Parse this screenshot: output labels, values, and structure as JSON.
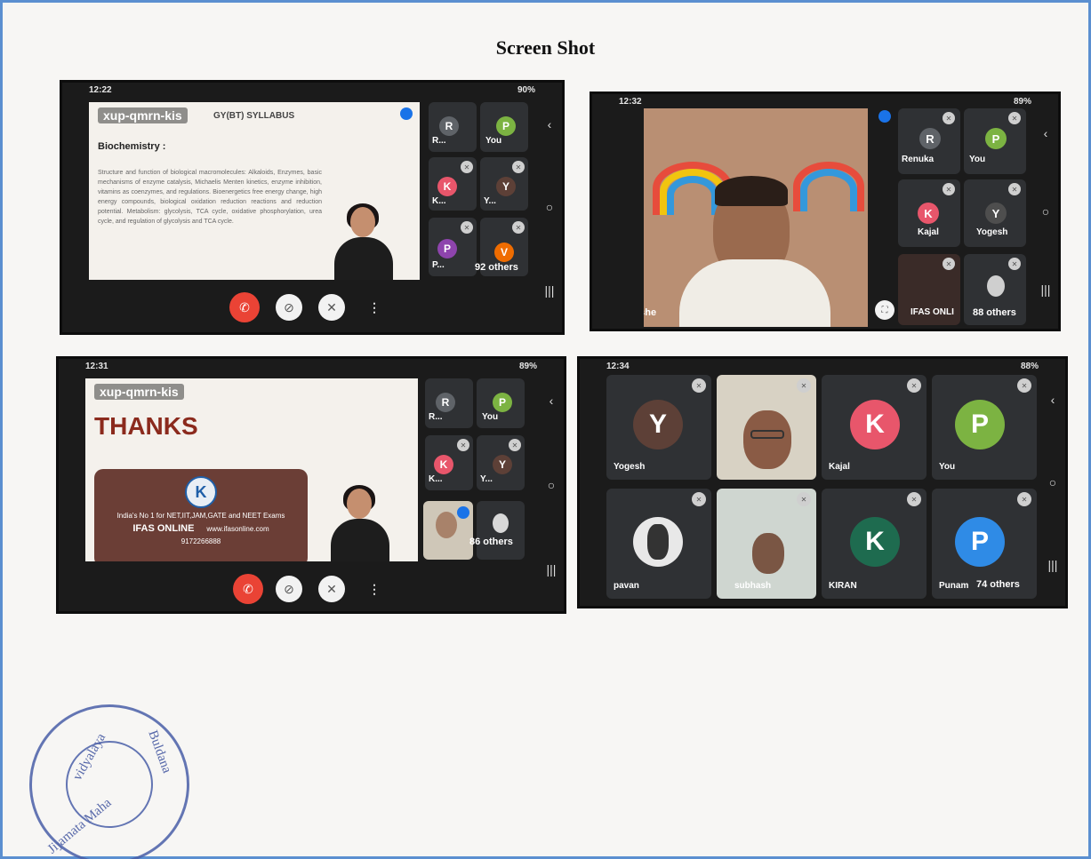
{
  "page": {
    "title": "Screen Shot"
  },
  "screenshots": [
    {
      "status_time": "12:22",
      "status_right": "90%",
      "slide": {
        "meeting_code": "xup-qmrn-kis",
        "header_fragment": "GY(BT) SYLLABUS",
        "heading": "Biochemistry :",
        "body": "Structure and function of biological macromolecules: Alkaloids, Enzymes, basic mechanisms of enzyme catalysis, Michaelis Menten kinetics, enzyme inhibition, vitamins as coenzymes, and regulations. Bioenergetics free energy change, high energy compounds, biological oxidation reduction reactions and reduction potential. Metabolism: glycolysis, TCA cycle, oxidative phosphorylation, urea cycle, and regulation of glycolysis and TCA cycle."
      },
      "tiles": [
        {
          "initial": "R",
          "label": "R...",
          "color": "#5f6368"
        },
        {
          "initial": "P",
          "label": "You",
          "color": "#7cb342"
        },
        {
          "initial": "K",
          "label": "K...",
          "color": "#e8566b"
        },
        {
          "initial": "Y",
          "label": "Y...",
          "color": "#5d4037"
        },
        {
          "initial": "P",
          "label": "P...",
          "color": "#8e44ad"
        },
        {
          "initial": "V",
          "label": "92 others",
          "color": "#ef6c00"
        }
      ]
    },
    {
      "status_time": "12:32",
      "status_right": "89%",
      "main_label": "prashe",
      "tiles": [
        {
          "initial": "R",
          "label": "Renuka",
          "color": "#5f6368"
        },
        {
          "initial": "P",
          "label": "You",
          "color": "#7cb342"
        },
        {
          "initial": "K",
          "label": "Kajal",
          "color": "#e8566b"
        },
        {
          "initial": "Y",
          "label": "Yogesh",
          "color": "#4e4e4e"
        },
        {
          "initial": "",
          "label": "IFAS ONLI",
          "color": "#3a2b28"
        },
        {
          "initial": "",
          "label": "88 others",
          "color": "#2f3134"
        }
      ]
    },
    {
      "status_time": "12:31",
      "status_right": "89%",
      "slide": {
        "meeting_code": "xup-qmrn-kis",
        "thanks": "THANKS",
        "tagline": "India's No 1 for NET,IIT,JAM,GATE and NEET Exams",
        "brand": "IFAS ONLINE",
        "url": "www.ifasonline.com",
        "phone": "9172266888"
      },
      "tiles": [
        {
          "initial": "R",
          "label": "R...",
          "color": "#5f6368"
        },
        {
          "initial": "P",
          "label": "You",
          "color": "#7cb342"
        },
        {
          "initial": "K",
          "label": "K...",
          "color": "#e8566b"
        },
        {
          "initial": "Y",
          "label": "Y...",
          "color": "#5d4037"
        },
        {
          "initial": "",
          "label": "",
          "color": "#cfc7b8"
        },
        {
          "initial": "",
          "label": "86 others",
          "color": "#2f3134"
        }
      ]
    },
    {
      "status_time": "12:34",
      "status_right": "88%",
      "tiles": [
        {
          "initial": "Y",
          "label": "Yogesh",
          "color": "#5d4037"
        },
        {
          "initial": "",
          "label": "",
          "color": "#d8d2c4"
        },
        {
          "initial": "K",
          "label": "Kajal",
          "color": "#e8566b"
        },
        {
          "initial": "P",
          "label": "You",
          "color": "#7cb342"
        },
        {
          "initial": "",
          "label": "pavan",
          "color": "#3a3a3a"
        },
        {
          "initial": "",
          "label": "subhash",
          "color": "#cfd6d0"
        },
        {
          "initial": "K",
          "label": "KIRAN",
          "color": "#1e6b4f"
        },
        {
          "initial": "P",
          "label": "Punam",
          "color": "#2f8be6"
        }
      ],
      "others": "74 others"
    }
  ],
  "stamp": {
    "text": "Jijamata Mahavidyalaya",
    "city": "Buldana"
  }
}
